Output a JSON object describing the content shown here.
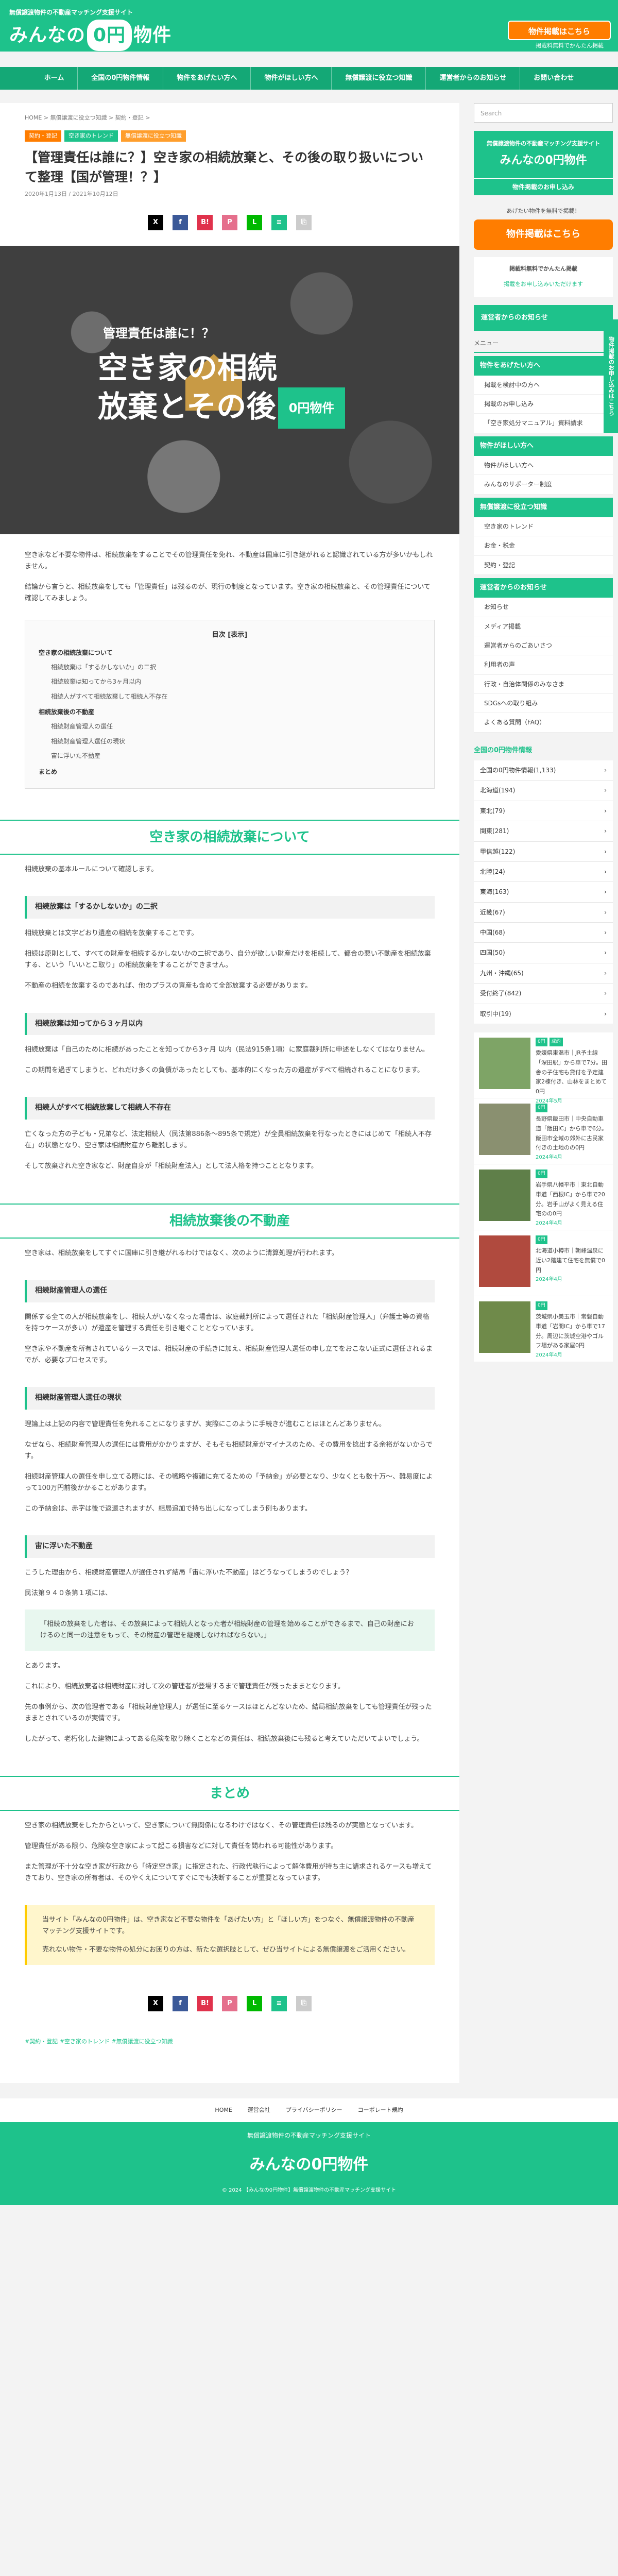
{
  "header": {
    "tagline": "無償譲渡物件の不動産マッチング支援サイト",
    "logo": "みんなの0円物件",
    "cta": "物件掲載はこちら",
    "cta_note": "掲載料無料でかんたん掲載"
  },
  "nav": [
    "ホーム",
    "全国の0円物件情報",
    "物件をあげたい方へ",
    "物件がほしい方へ",
    "無償譲渡に役立つ知識",
    "運営者からのお知らせ",
    "お問い合わせ"
  ],
  "article": {
    "breadcrumb": "HOME > 無償譲渡に役立つ知識 > 契約・登記 >",
    "categories": [
      "契約・登記",
      "空き家のトレンド",
      "無償譲渡に役立つ知識"
    ],
    "title": "【管理責任は誰に？】空き家の相続放棄と、その後の取り扱いについて整理【国が管理！？】",
    "dates": "2020年1月13日 / 2021年10月12日",
    "eyecatch_sub": "管理責任は誰に！？",
    "eyecatch_main": "空き家の相続放棄とその後",
    "eyecatch_badge": "0円物件",
    "intro1": "空き家など不要な物件は、相続放棄をすることでその管理責任を免れ、不動産は国庫に引き継がれると認識されている方が多いかもしれません。",
    "intro2": "結論から言うと、相続放棄をしても「管理責任」は残るのが、現行の制度となっています。空き家の相続放棄と、その管理責任について確認してみましょう。",
    "toc_title": "目次 [表示]",
    "toc": [
      {
        "h": "空き家の相続放棄について",
        "items": [
          "相続放棄は「するかしないか」の二択",
          "相続放棄は知ってから3ヶ月以内",
          "相続人がすべて相続放棄して相続人不存在"
        ]
      },
      {
        "h": "相続放棄後の不動産",
        "items": [
          "相続財産管理人の選任",
          "相続財産管理人選任の現状",
          "宙に浮いた不動産"
        ]
      },
      {
        "h": "まとめ",
        "items": []
      }
    ],
    "sec1": "空き家の相続放棄について",
    "sec1_intro": "相続放棄の基本ルールについて確認します。",
    "sub1": "相続放棄は「するかしないか」の二択",
    "sub1_p1": "相続放棄とは文字どおり遺産の相続を放棄することです。",
    "sub1_p2": "相続は原則として、すべての財産を相続するかしないかの二択であり、自分が欲しい財産だけを相続して、都合の悪い不動産を相続放棄する、という「いいとこ取り」の相続放棄をすることができません。",
    "sub1_p3": "不動産の相続を放棄するのであれば、他のプラスの資産も含めて全部放棄する必要があります。",
    "sub2": "相続放棄は知ってから３ヶ月以内",
    "sub2_p1": "相続放棄は「自己のために相続があったことを知ってから3ヶ月 以内（民法915条1項）に家庭裁判所に申述をしなくてはなりません。",
    "sub2_p2": "この期間を過ぎてしまうと、どれだけ多くの負債があったとしても、基本的にくなった方の遺産がすべて相続されることになります。",
    "sub3": "相続人がすべて相続放棄して相続人不存在",
    "sub3_p1": "亡くなった方の子ども・兄弟など、法定相続人（民法第886条〜895条で規定）が全員相続放棄を行なったときにはじめて「相続人不存在」の状態となり、空き家は相続財産から離脱します。",
    "sub3_p2": "そして放棄された空き家など、財産自身が「相続財産法人」として法人格を持つこととなります。",
    "sec2": "相続放棄後の不動産",
    "sec2_intro": "空き家は、相続放棄をしてすぐに国庫に引き継がれるわけではなく、次のように清算処理が行われます。",
    "sub4": "相続財産管理人の選任",
    "sub4_p1": "関係する全ての人が相続放棄をし、相続人がいなくなった場合は、家庭裁判所によって選任された「相続財産管理人」（弁護士等の資格を持つケースが多い）が遺産を管理する責任を引き継ぐこととなっています。",
    "sub4_p2": "空き家や不動産を所有されているケースでは、相続財産の手続きに加え、相続財産管理人選任の申し立てをおこない正式に選任されるまでが、必要なプロセスです。",
    "sub5": "相続財産管理人選任の現状",
    "sub5_p1": "理論上は上記の内容で管理責任を免れることになりますが、実際にこのように手続きが進むことはほとんどありません。",
    "sub5_p2": "なぜなら、相続財産管理人の選任には費用がかかりますが、そもそも相続財産がマイナスのため、その費用を捻出する余裕がないからです。",
    "sub5_p3": "相続財産管理人の選任を申し立てる際には、その戦略や複雑に充てるための「予納金」が必要となり、少なくとも数十万〜、難易度によって100万円前後かかることがあります。",
    "sub5_p4": "この予納金は、赤字は後で返還されますが、結局追加で持ち出しになってしまう例もあります。",
    "sub6": "宙に浮いた不動産",
    "sub6_p1": "こうした理由から、相続財産管理人が選任されず結局「宙に浮いた不動産」はどうなってしまうのでしょう？",
    "sub6_p2": "民法第９４０条第１項には、",
    "quote": "「相続の放棄をした者は、その放棄によって相続人となった者が相続財産の管理を始めることができるまで、自己の財産におけるのと同一の注意をもって、その財産の管理を継続しなければならない。」",
    "sub6_p3": "とあります。",
    "sub6_p4": "これにより、相続放棄者は相続財産に対して次の管理者が登場するまで管理責任が残ったままとなります。",
    "sub6_p5": "先の事例から、次の管理者である「相続財産管理人」が選任に至るケースはほとんどないため、結局相続放棄をしても管理責任が残ったままとされているのが実情です。",
    "sub6_p6": "したがって、老朽化した建物によってある危険を取り除くことなどの責任は、相続放棄後にも残ると考えていただいてよいでしょう。",
    "sec3": "まとめ",
    "sum1": "空き家の相続放棄をしたからといって、空き家について無関係になるわけではなく、その管理責任は残るのが実態となっています。",
    "sum2": "管理責任がある限り、危険な空き家によって起こる損害などに対して責任を問われる可能性があります。",
    "sum3": "また管理が不十分な空き家が行政から「特定空き家」に指定された、行政代執行によって解体費用が持ち主に請求されるケースも増えてきており、空き家の所有者は、そのやくえについてすぐにでも決断することが重要となっています。",
    "note1": "当サイト「みんなの0円物件」は、空き家など不要な物件を「あげたい方」と「ほしい方」をつなぐ、無償譲渡物件の不動産マッチング支援サイトです。",
    "note2": "売れない物件・不要な物件の処分にお困りの方は、新たな選択肢として、ぜひ当サイトによる無償譲渡をご活用ください。",
    "bottom_links": "#契約・登記 #空き家のトレンド #無償譲渡に役立つ知識"
  },
  "share": [
    {
      "label": "X",
      "color": "#000000"
    },
    {
      "label": "f",
      "color": "#3b5998"
    },
    {
      "label": "B!",
      "color": "#e0324c"
    },
    {
      "label": "P",
      "color": "#e56f8c"
    },
    {
      "label": "L",
      "color": "#00b900"
    },
    {
      "label": "≡",
      "color": "#1ec28b"
    },
    {
      "label": "⎘",
      "color": "#cccccc"
    }
  ],
  "side": {
    "search_placeholder": "Search",
    "banner_tag": "無償譲渡物件の不動産マッチング支援サイト",
    "banner_logo": "みんなの0円物件",
    "banner_link": "物件掲載のお申し込み",
    "banner_note": "あげたい物件を無料で掲載！",
    "cta": "物件掲載はこちら",
    "note_head": "掲載料無料でかんたん掲載",
    "note_link": "掲載をお申し込みいただけます",
    "notice": "運営者からのお知らせ",
    "menu_head": "メニュー",
    "menus": [
      {
        "h": "物件をあげたい方へ",
        "items": [
          "掲載を検討中の方へ",
          "掲載のお申し込み",
          "「空き家処分マニュアル」資料請求"
        ]
      },
      {
        "h": "物件がほしい方へ",
        "items": [
          "物件がほしい方へ",
          "みんなのサポーター制度"
        ]
      },
      {
        "h": "無償譲渡に役立つ知識",
        "items": [
          "空き家のトレンド",
          "お金・税金",
          "契約・登記"
        ]
      },
      {
        "h": "運営者からのお知らせ",
        "items": [
          "お知らせ",
          "メディア掲載",
          "運営者からのごあいさつ",
          "利用者の声",
          "行政・自治体関係のみなさま",
          "SDGsへの取り組み",
          "よくある質問（FAQ）"
        ]
      }
    ],
    "regions_head": "全国の0円物件情報",
    "regions": [
      {
        "n": "全国の0円物件情報",
        "c": "(1,133)"
      },
      {
        "n": "北海道",
        "c": "(194)"
      },
      {
        "n": "東北",
        "c": "(79)"
      },
      {
        "n": "関東",
        "c": "(281)"
      },
      {
        "n": "甲信越",
        "c": "(122)"
      },
      {
        "n": "北陸",
        "c": "(24)"
      },
      {
        "n": "東海",
        "c": "(163)"
      },
      {
        "n": "近畿",
        "c": "(67)"
      },
      {
        "n": "中国",
        "c": "(68)"
      },
      {
        "n": "四国",
        "c": "(50)"
      },
      {
        "n": "九州・沖縄",
        "c": "(65)"
      },
      {
        "n": "受付終了",
        "c": "(842)"
      },
      {
        "n": "取引中",
        "c": "(19)"
      }
    ],
    "props": [
      {
        "t": "愛媛県東温市｜JR予土線「深田駅」から車で7分。田舎の子住宅も貸付を予定建家2棟付き、山林をまとめて0円",
        "d": "2024年5月",
        "tags": [
          "0円",
          "成約"
        ],
        "color": "#7ea466"
      },
      {
        "t": "長野県飯田市｜中央自動車道「飯田IC」から車で6分。飯田市全域の郊外に古民家付きの土地のの0円",
        "d": "2024年4月",
        "tags": [
          "0円"
        ],
        "color": "#8a9070"
      },
      {
        "t": "岩手県八幡平市｜東北自動車道「西根IC」から車で20分。岩手山がよく見える住宅のの0円",
        "d": "2024年4月",
        "tags": [
          "0円"
        ],
        "color": "#5f7f49"
      },
      {
        "t": "北海道小樽市｜朝峰温泉に近い2階建て住宅を無償で0円",
        "d": "2024年4月",
        "tags": [
          "0円"
        ],
        "color": "#b04a3e"
      },
      {
        "t": "茨城県小美玉市｜常磐自動車道「岩間IC」から車で17分。周辺に茨城空港やゴルフ場がある家屋0円",
        "d": "2024年4月",
        "tags": [
          "0円"
        ],
        "color": "#6f8a4a"
      }
    ],
    "vertical": "物件掲載のお申し込みはこちら"
  },
  "footer": {
    "links": [
      "HOME",
      "運営会社",
      "プライバシーポリシー",
      "コーポレート規約"
    ],
    "tag": "無償譲渡物件の不動産マッチング支援サイト",
    "logo": "みんなの0円物件",
    "copy": "© 2024 【みんなの0円物件】無償譲渡物件の不動産マッチング支援サイト"
  }
}
